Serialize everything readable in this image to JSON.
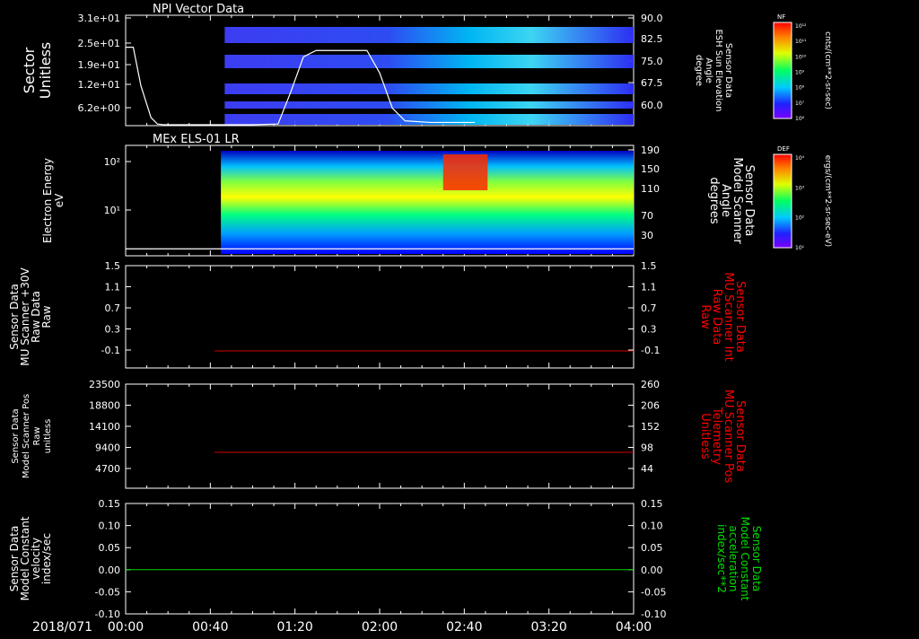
{
  "time_axis": {
    "date": "2018/071",
    "ticks": [
      "00:00",
      "00:40",
      "01:20",
      "02:00",
      "02:40",
      "03:20",
      "04:00"
    ],
    "range_hours": [
      0,
      4
    ]
  },
  "chart_data": [
    {
      "type": "heatmap",
      "title": "NPI Vector Data",
      "ylabel": [
        "Sector",
        "Unitless"
      ],
      "yticks": [
        "3.1e+01",
        "2.5e+01",
        "1.9e+01",
        "1.2e+01",
        "6.2e+00"
      ],
      "right_ylabel": [
        "Sensor Data",
        "ESH Sun Elevation",
        "Angle",
        "degree"
      ],
      "right_yticks": [
        "90.0",
        "82.5",
        "75.0",
        "67.5",
        "60.0"
      ],
      "right_ylim": [
        55.5,
        90
      ],
      "colorbar": {
        "label": "NF",
        "unit": "cnts/(cm**2-sr-sec)",
        "ticks": [
          "10¹²",
          "10¹¹",
          "10¹⁰",
          "10⁹",
          "10⁸",
          "10⁷",
          "10⁶"
        ]
      },
      "data_start_hours": 0.78,
      "line": {
        "name": "ESH Sun Elevation Angle",
        "color": "#ffffff",
        "x_hours": [
          0.0,
          0.06,
          0.12,
          0.2,
          0.25,
          0.3,
          1.0,
          1.2,
          1.3,
          1.4,
          1.5,
          1.9,
          2.0,
          2.1,
          2.2,
          2.4,
          2.6,
          2.7,
          2.75
        ],
        "y": [
          80,
          80,
          68,
          58,
          56,
          55.8,
          55.8,
          56,
          66,
          77,
          79,
          79,
          72,
          61,
          57,
          56.5,
          56.5,
          56.5,
          56.5
        ]
      }
    },
    {
      "type": "heatmap",
      "title": "MEx ELS-01 LR",
      "ylabel": [
        "Electron Energy",
        "eV"
      ],
      "yticks": [
        "10²",
        "10¹"
      ],
      "right_ylabel": [
        "Sensor Data",
        "Model Scanner",
        "Angle",
        "degrees"
      ],
      "right_yticks": [
        "190",
        "150",
        "110",
        "70",
        "30"
      ],
      "right_ylim": [
        0,
        190
      ],
      "colorbar": {
        "label": "DEF",
        "unit": "ergs/(cm**2-sr-sec-eV)",
        "ticks": [
          "10⁴",
          "10³",
          "10²",
          "10¹"
        ]
      },
      "data_start_hours": 0.75,
      "line": {
        "name": "Model Scanner Angle",
        "color": "#ffffff",
        "x_hours": [
          0,
          4
        ],
        "y": [
          12,
          12
        ]
      }
    },
    {
      "type": "line",
      "ylabel": [
        "Sensor Data",
        "MU Scanner +30V",
        "Raw Data",
        "Raw"
      ],
      "yticks": [
        "1.5",
        "1.1",
        "0.7",
        "0.3",
        "-0.1"
      ],
      "ylim": [
        -0.3,
        1.5
      ],
      "right_ylabel": [
        "Sensor Data",
        "MU Scanner Int",
        "Raw Data",
        "Raw"
      ],
      "right_yticks": [
        "1.5",
        "1.1",
        "0.7",
        "0.3",
        "-0.1"
      ],
      "right_color": "#ff0000",
      "series": [
        {
          "color": "#d00000",
          "x_hours": [
            0.7,
            4
          ],
          "y": [
            0,
            0
          ]
        }
      ]
    },
    {
      "type": "line",
      "ylabel": [
        "Sensor Data",
        "Model Scanner Pos",
        "Raw",
        "unitless"
      ],
      "yticks": [
        "23500",
        "18800",
        "14100",
        "9400",
        "4700"
      ],
      "ylim": [
        0,
        23500
      ],
      "right_ylabel": [
        "Sensor Data",
        "MU Scanner Pos",
        "Telemetry",
        "Unitless"
      ],
      "right_yticks": [
        "260",
        "206",
        "152",
        "98",
        "44"
      ],
      "right_ylim": [
        -10,
        260
      ],
      "right_color": "#ff0000",
      "series": [
        {
          "color": "#d00000",
          "x_hours": [
            0.7,
            4
          ],
          "y": [
            8100,
            8100
          ]
        }
      ]
    },
    {
      "type": "line",
      "ylabel": [
        "Sensor Data",
        "Model Constant",
        "velocity",
        "index/sec"
      ],
      "yticks": [
        "0.15",
        "0.10",
        "0.05",
        "0.00",
        "-0.05",
        "-0.10"
      ],
      "ylim": [
        -0.1,
        0.15
      ],
      "right_ylabel": [
        "Sensor Data",
        "Model Constant",
        "acceleration",
        "index/sec**2"
      ],
      "right_yticks": [
        "0.15",
        "0.10",
        "0.05",
        "0.00",
        "-0.05",
        "-0.10"
      ],
      "right_color": "#00e000",
      "series": [
        {
          "color": "#00d000",
          "x_hours": [
            0,
            4
          ],
          "y": [
            0,
            0
          ]
        }
      ]
    }
  ]
}
